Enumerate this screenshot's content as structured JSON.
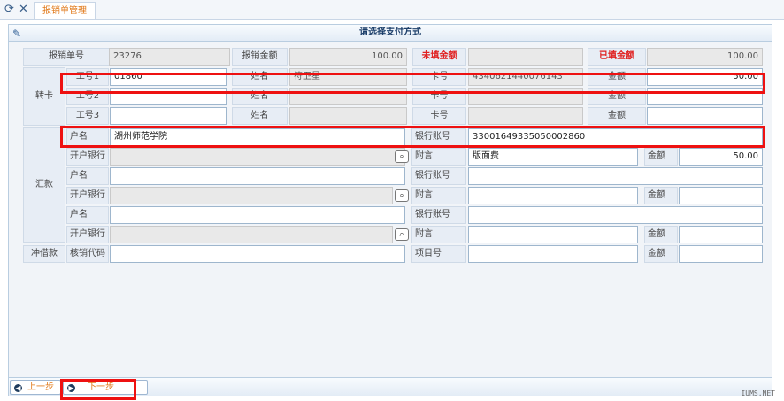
{
  "tab_title": "报销单管理",
  "panel_title": "请选择支付方式",
  "summary": {
    "id_label": "报销单号",
    "id_value": "23276",
    "amount_label": "报销金额",
    "amount_value": "100.00",
    "unfilled_label": "未填金额",
    "unfilled_value": "",
    "filled_label": "已填金额",
    "filled_value": "100.00"
  },
  "transfer": {
    "section_label": "转卡",
    "rows": [
      {
        "emp_label": "工号1",
        "emp_value": "01860",
        "name_label": "姓名",
        "name_value": "符卫星",
        "card_label": "卡号",
        "card_value": "4340621440076143",
        "amount_label": "金额",
        "amount_value": "50.00"
      },
      {
        "emp_label": "工号2",
        "emp_value": "",
        "name_label": "姓名",
        "name_value": "",
        "card_label": "卡号",
        "card_value": "",
        "amount_label": "金额",
        "amount_value": ""
      },
      {
        "emp_label": "工号3",
        "emp_value": "",
        "name_label": "姓名",
        "name_value": "",
        "card_label": "卡号",
        "card_value": "",
        "amount_label": "金额",
        "amount_value": ""
      }
    ]
  },
  "remit": {
    "section_label": "汇款",
    "groups": [
      {
        "holder_label": "户名",
        "holder_value": "湖州师范学院",
        "account_label": "银行账号",
        "account_value": "33001649335050002860",
        "bank_label": "开户银行",
        "bank_value": "",
        "note_label": "附言",
        "note_value": "版面费",
        "amount_label": "金额",
        "amount_value": "50.00"
      },
      {
        "holder_label": "户名",
        "holder_value": "",
        "account_label": "银行账号",
        "account_value": "",
        "bank_label": "开户银行",
        "bank_value": "",
        "note_label": "附言",
        "note_value": "",
        "amount_label": "金额",
        "amount_value": ""
      },
      {
        "holder_label": "户名",
        "holder_value": "",
        "account_label": "银行账号",
        "account_value": "",
        "bank_label": "开户银行",
        "bank_value": "",
        "note_label": "附言",
        "note_value": "",
        "amount_label": "金额",
        "amount_value": ""
      }
    ]
  },
  "offset": {
    "section_label": "冲借款",
    "code_label": "核销代码",
    "code_value": "",
    "project_label": "项目号",
    "project_value": "",
    "amount_label": "金额",
    "amount_value": ""
  },
  "nav": {
    "prev_label": "上一步",
    "next_label": "下一步"
  },
  "watermark": "IUMS.NET"
}
